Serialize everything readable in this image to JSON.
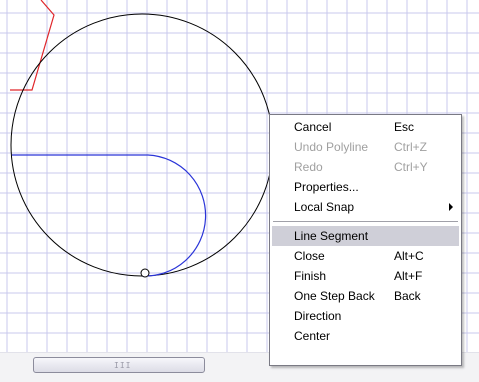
{
  "colors": {
    "grid": "#c9c9ec",
    "circle": "#000000",
    "polyline": "#2a34d8",
    "red_shape": "#e0262a",
    "menu_highlight": "#cfcfd8"
  },
  "horizontal_scrollbar": {
    "grip": "III"
  },
  "context_menu": {
    "items": [
      {
        "label": "Cancel",
        "shortcut": "Esc",
        "enabled": true
      },
      {
        "label": "Undo Polyline",
        "shortcut": "Ctrl+Z",
        "enabled": false
      },
      {
        "label": "Redo",
        "shortcut": "Ctrl+Y",
        "enabled": false
      },
      {
        "label": "Properties...",
        "shortcut": "",
        "enabled": true
      },
      {
        "label": "Local Snap",
        "shortcut": "",
        "enabled": true,
        "submenu": true
      },
      {
        "label": "Line Segment",
        "shortcut": "",
        "enabled": true,
        "selected": true
      },
      {
        "label": "Close",
        "shortcut": "Alt+C",
        "enabled": true
      },
      {
        "label": "Finish",
        "shortcut": "Alt+F",
        "enabled": true
      },
      {
        "label": "One Step Back",
        "shortcut": "Back",
        "enabled": true
      },
      {
        "label": "Direction",
        "shortcut": "",
        "enabled": true
      },
      {
        "label": "Center",
        "shortcut": "",
        "enabled": true
      }
    ]
  }
}
